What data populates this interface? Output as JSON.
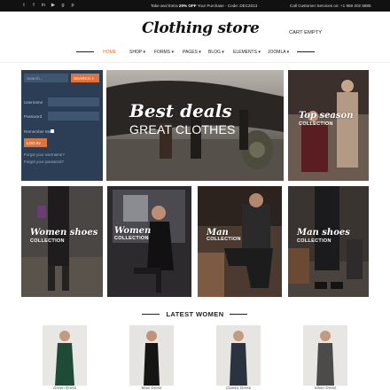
{
  "topbar": {
    "social_icons": [
      "twitter-icon",
      "facebook-icon",
      "linkedin-icon",
      "youtube-icon",
      "google-plus-icon",
      "pinterest-icon"
    ],
    "promo_prefix": "Take and Extra ",
    "promo_bold": "20% OFF",
    "promo_suffix": " Your Purchase - Code: DEC2013",
    "service": "Call Customer Services on: +1 959 202 5895"
  },
  "header": {
    "logo": "Clothing store",
    "cart": "CART EMPTY"
  },
  "nav": {
    "items": [
      {
        "label": "HOME",
        "active": true
      },
      {
        "label": "SHOP ▾"
      },
      {
        "label": "FORMS ▾"
      },
      {
        "label": "PAGES ▾"
      },
      {
        "label": "BLOG ▾"
      },
      {
        "label": "ELEMENTS ▾"
      },
      {
        "label": "JOOMLA ▾"
      }
    ]
  },
  "login": {
    "search_placeholder": "Search...",
    "search_button": "SEARCH",
    "username_label": "Username",
    "password_label": "Password",
    "remember_label": "Remember Me",
    "login_button": "LOG IN",
    "forgot_username": "Forgot your username?",
    "forgot_password": "Forgot your password?"
  },
  "banners": {
    "hero_line1": "Best deals",
    "hero_line2": "GREAT CLOTHES",
    "top_season": "Top season",
    "top_season_sub": "COLLECTION",
    "women_shoes": "Women shoes",
    "women_shoes_sub": "COLLECTION",
    "women": "Women",
    "women_sub": "COLLECTION",
    "man": "Man",
    "man_sub": "COLLECTION",
    "man_shoes": "Man shoes",
    "man_shoes_sub": "COLLECTION"
  },
  "latest": {
    "title": "LATEST WOMEN",
    "products": [
      "Green Dress",
      "Maxi Dress",
      "Classic Dress",
      "Silver Dress"
    ]
  },
  "colors": {
    "accent": "#e0733a",
    "login_bg": "#2b3e55",
    "topbar_bg": "#111111"
  }
}
